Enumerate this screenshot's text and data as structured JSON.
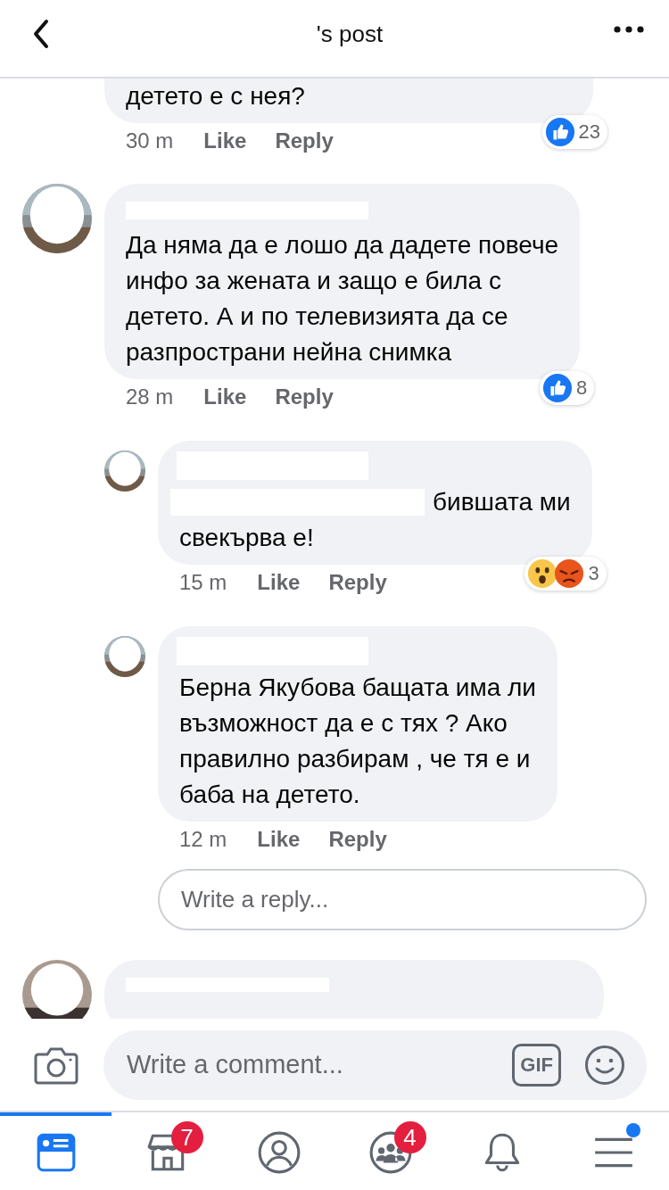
{
  "header": {
    "title": "'s post"
  },
  "partial_comment": {
    "lines": [
      "детето е с нея?"
    ],
    "time": "30 m",
    "like": "Like",
    "reply": "Reply",
    "reactions": [
      {
        "kind": "like"
      }
    ],
    "reaction_count": "23"
  },
  "comments": [
    {
      "lines": [
        "Да няма да е лошо да дадете повече",
        "инфо за жената и защо е била с",
        "детето. А и по телевизията да се",
        "разпространи нейна снимка"
      ],
      "time": "28 m",
      "like": "Like",
      "reply": "Reply",
      "reactions": [
        {
          "kind": "like"
        }
      ],
      "reaction_count": "8",
      "replies": [
        {
          "inline_redaction": true,
          "lines": [
            "бившата ми",
            "свекърва е!"
          ],
          "time": "15 m",
          "like": "Like",
          "reply": "Reply",
          "reactions": [
            {
              "kind": "wow"
            },
            {
              "kind": "angry"
            }
          ],
          "reaction_count": "3"
        },
        {
          "lines": [
            "Берна Якубова бащата има ли",
            "възможност да е с тях ? Ако",
            "правилно разбирам , че тя е и",
            "баба на детето."
          ],
          "time": "12 m",
          "like": "Like",
          "reply": "Reply"
        }
      ]
    }
  ],
  "reply_field": {
    "placeholder": "Write a reply..."
  },
  "composer": {
    "placeholder": "Write a comment...",
    "gif": "GIF"
  },
  "tabs": [
    {
      "kind": "feed",
      "selected": true
    },
    {
      "kind": "shop",
      "selected": false,
      "badge": "7"
    },
    {
      "kind": "profile",
      "selected": false
    },
    {
      "kind": "groups",
      "selected": false,
      "badge": "4"
    },
    {
      "kind": "bell",
      "selected": false
    },
    {
      "kind": "menu",
      "selected": false,
      "dot": true
    }
  ]
}
